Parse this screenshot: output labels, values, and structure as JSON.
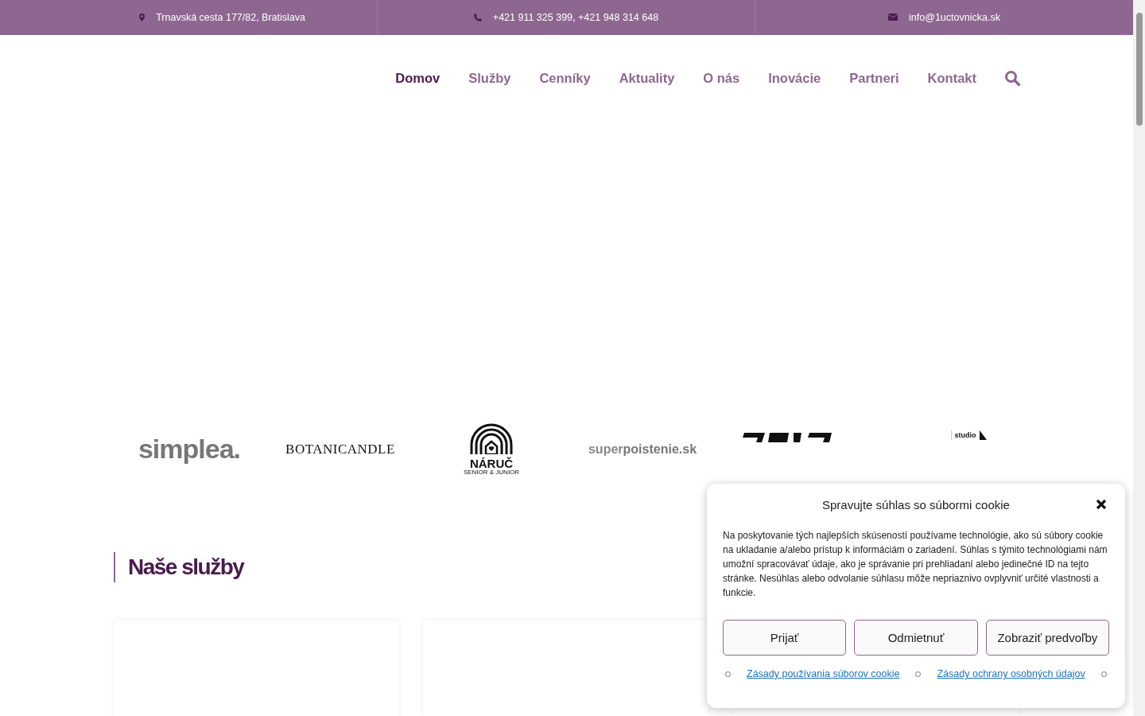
{
  "topbar": [
    {
      "kind": "location",
      "text": "Trnavská cesta 177/82, Bratislava"
    },
    {
      "kind": "phone",
      "text": "+421 911 325 399, +421 948 314 648"
    },
    {
      "kind": "email",
      "text": "info@1uctovnicka.sk"
    }
  ],
  "nav": [
    {
      "label": "Domov",
      "selected": true
    },
    {
      "label": "Služby",
      "selected": false
    },
    {
      "label": "Cenníky",
      "selected": false
    },
    {
      "label": "Aktuality",
      "selected": false
    },
    {
      "label": "O nás",
      "selected": false
    },
    {
      "label": "Inovácie",
      "selected": false
    },
    {
      "label": "Partneri",
      "selected": false
    },
    {
      "label": "Kontakt",
      "selected": false
    }
  ],
  "partners": [
    {
      "kind": "simplea",
      "text": "simplea."
    },
    {
      "kind": "botanicandle",
      "text": "BOTANICANDLE"
    },
    {
      "kind": "naruc",
      "text": "NÁRUČ",
      "subtext": "SENIOR & JUNIOR"
    },
    {
      "kind": "superpoistenie",
      "text": "super",
      "bold_text": "poistenie.sk"
    },
    {
      "kind": "blackmark"
    },
    {
      "kind": "studio",
      "text": "studio"
    }
  ],
  "section": {
    "title": "Naše služby"
  },
  "cookie": {
    "title": "Spravujte súhlas so súbormi cookie",
    "text": "Na poskytovanie tých najlepších skúseností používame technológie, ako sú súbory cookie na ukladanie a/alebo prístup k informáciám o zariadení. Súhlas s týmito technológiami nám umožní spracovávať údaje, ako je správanie pri prehliadaní alebo jedinečné ID na tejto stránke. Nesúhlas alebo odvolanie súhlasu môže nepriaznivo ovplyvniť určité vlastnosti a funkcie.",
    "buttons": [
      "Prijať",
      "Odmietnuť",
      "Zobraziť predvoľby"
    ],
    "links": [
      "Zásady používania súborov cookie",
      "Zásady ochrany osobných údajov"
    ]
  }
}
